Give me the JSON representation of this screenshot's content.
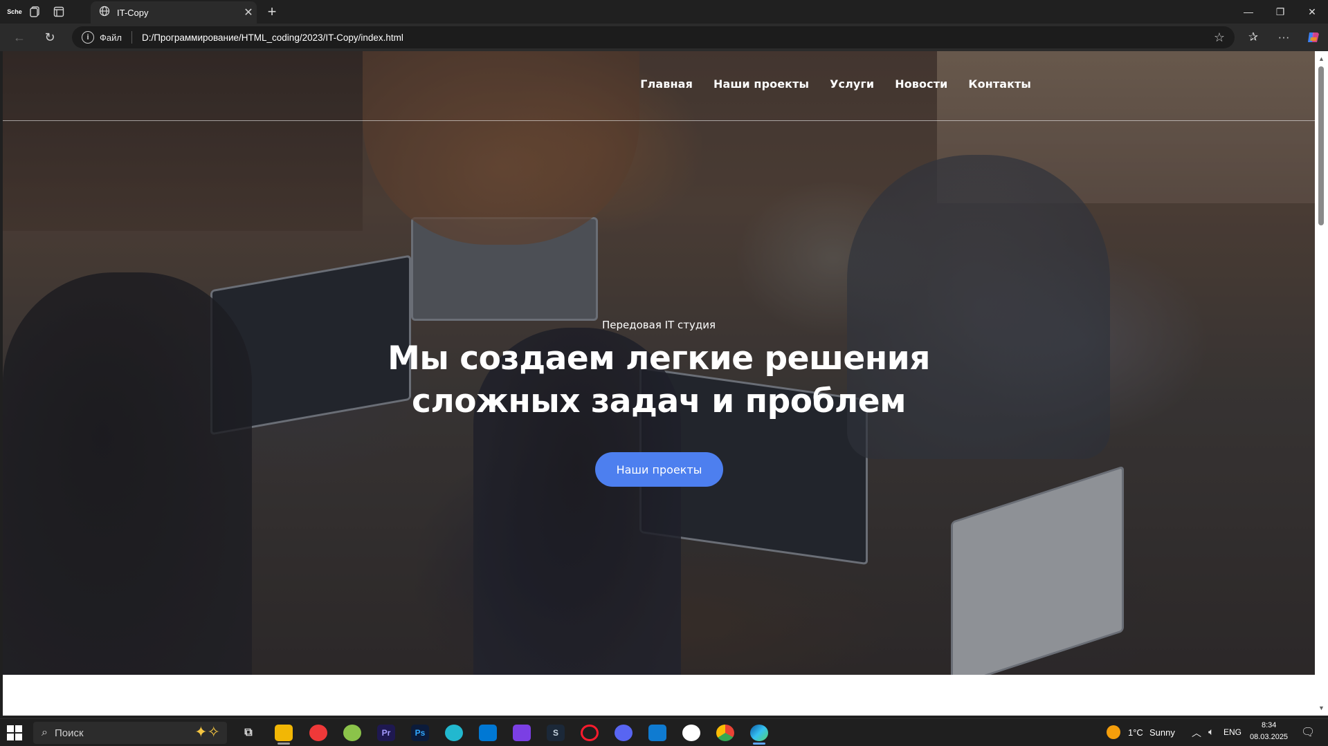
{
  "browser": {
    "tab_title": "IT-Copy",
    "address_scheme": "Файл",
    "address_url": "D:/Программирование/HTML_coding/2023/IT-Copy/index.html"
  },
  "site": {
    "nav": [
      "Главная",
      "Наши проекты",
      "Услуги",
      "Новости",
      "Контакты"
    ],
    "hero_subtitle": "Передовая IT студия",
    "hero_title_line1": "Мы создаем легкие решения",
    "hero_title_line2": "сложных задач и проблем",
    "hero_button": "Наши проекты",
    "button_color": "#4d7fef"
  },
  "taskbar": {
    "search_placeholder": "Поиск",
    "weather_temp": "1°C",
    "weather_text": "Sunny",
    "language": "ENG",
    "time": "8:34",
    "date": "08.03.2025",
    "apps": [
      "file-explorer",
      "vivaldi",
      "krita",
      "premiere-pro",
      "photoshop",
      "browser",
      "vscode",
      "visual-studio",
      "steam",
      "opera",
      "discord",
      "outlook",
      "overwatch",
      "chrome",
      "edge"
    ]
  }
}
